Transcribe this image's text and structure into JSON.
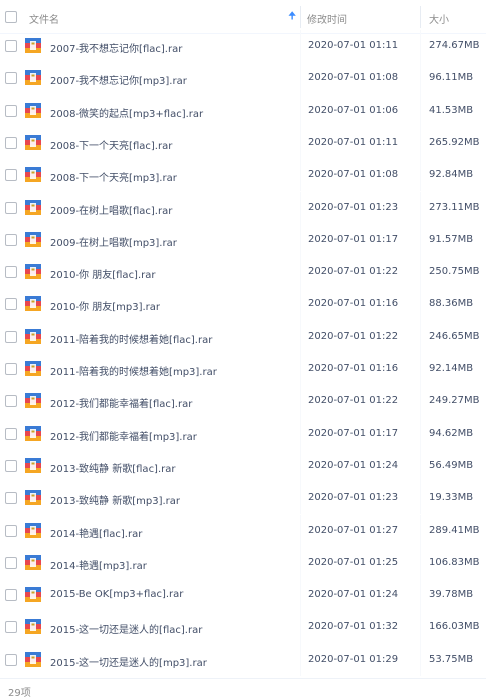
{
  "header": {
    "name_label": "文件名",
    "sort_icon": "arrow-up-icon",
    "time_label": "修改时间",
    "size_label": "大小"
  },
  "file_icon": "rar-archive-icon",
  "colors": {
    "accent": "#3b8cff",
    "text": "#424e67",
    "muted": "#8c8c8c"
  },
  "files": [
    {
      "name": "2007-我不想忘记你[flac].rar",
      "time": "2020-07-01 01:11",
      "size": "274.67MB"
    },
    {
      "name": "2007-我不想忘记你[mp3].rar",
      "time": "2020-07-01 01:08",
      "size": "96.11MB"
    },
    {
      "name": "2008-微笑的起点[mp3+flac].rar",
      "time": "2020-07-01 01:06",
      "size": "41.53MB"
    },
    {
      "name": "2008-下一个天亮[flac].rar",
      "time": "2020-07-01 01:11",
      "size": "265.92MB"
    },
    {
      "name": "2008-下一个天亮[mp3].rar",
      "time": "2020-07-01 01:08",
      "size": "92.84MB"
    },
    {
      "name": "2009-在树上唱歌[flac].rar",
      "time": "2020-07-01 01:23",
      "size": "273.11MB"
    },
    {
      "name": "2009-在树上唱歌[mp3].rar",
      "time": "2020-07-01 01:17",
      "size": "91.57MB"
    },
    {
      "name": "2010-你 朋友[flac].rar",
      "time": "2020-07-01 01:22",
      "size": "250.75MB"
    },
    {
      "name": "2010-你 朋友[mp3].rar",
      "time": "2020-07-01 01:16",
      "size": "88.36MB"
    },
    {
      "name": "2011-陪着我的时候想着她[flac].rar",
      "time": "2020-07-01 01:22",
      "size": "246.65MB"
    },
    {
      "name": "2011-陪着我的时候想着她[mp3].rar",
      "time": "2020-07-01 01:16",
      "size": "92.14MB"
    },
    {
      "name": "2012-我们都能幸福着[flac].rar",
      "time": "2020-07-01 01:22",
      "size": "249.27MB"
    },
    {
      "name": "2012-我们都能幸福着[mp3].rar",
      "time": "2020-07-01 01:17",
      "size": "94.62MB"
    },
    {
      "name": "2013-致纯静 新歌[flac].rar",
      "time": "2020-07-01 01:24",
      "size": "56.49MB"
    },
    {
      "name": "2013-致纯静 新歌[mp3].rar",
      "time": "2020-07-01 01:23",
      "size": "19.33MB"
    },
    {
      "name": "2014-艳遇[flac].rar",
      "time": "2020-07-01 01:27",
      "size": "289.41MB"
    },
    {
      "name": "2014-艳遇[mp3].rar",
      "time": "2020-07-01 01:25",
      "size": "106.83MB"
    },
    {
      "name": "2015-Be OK[mp3+flac].rar",
      "time": "2020-07-01 01:24",
      "size": "39.78MB"
    },
    {
      "name": "2015-这一切还是迷人的[flac].rar",
      "time": "2020-07-01 01:32",
      "size": "166.03MB"
    },
    {
      "name": "2015-这一切还是迷人的[mp3].rar",
      "time": "2020-07-01 01:29",
      "size": "53.75MB"
    }
  ],
  "footer": {
    "count_label": "29项"
  }
}
